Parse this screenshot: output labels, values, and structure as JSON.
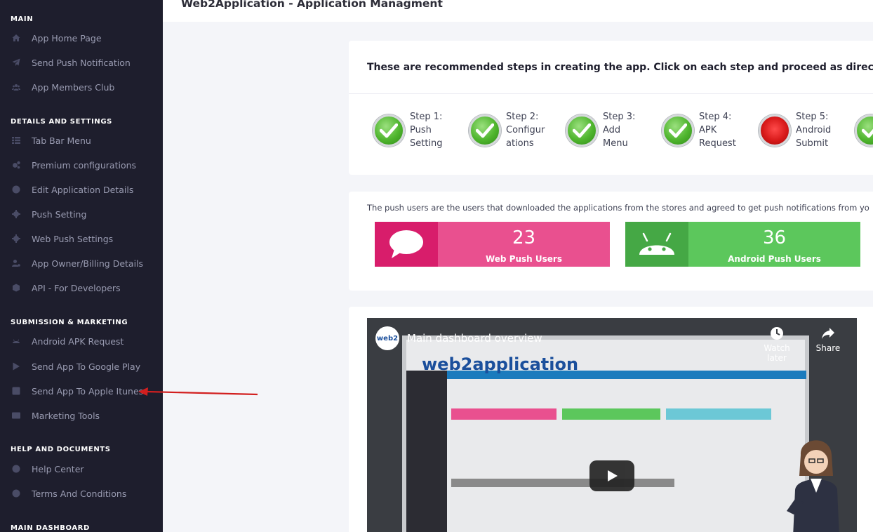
{
  "page": {
    "title": "Web2Application - Application Managment"
  },
  "sidebar": {
    "sections": [
      {
        "title": "MAIN",
        "items": [
          {
            "label": "App Home Page",
            "icon": "home-icon"
          },
          {
            "label": "Send Push Notification",
            "icon": "paper-plane-icon"
          },
          {
            "label": "App Members Club",
            "icon": "users-icon"
          }
        ]
      },
      {
        "title": "DETAILS AND SETTINGS",
        "items": [
          {
            "label": "Tab Bar Menu",
            "icon": "list-icon"
          },
          {
            "label": "Premium configurations",
            "icon": "cogs-icon"
          },
          {
            "label": "Edit Application Details",
            "icon": "info-icon"
          },
          {
            "label": "Push Setting",
            "icon": "gear-icon"
          },
          {
            "label": "Web Push Settings",
            "icon": "gear-icon"
          },
          {
            "label": "App Owner/Billing Details",
            "icon": "user-cog-icon"
          },
          {
            "label": "API - For Developers",
            "icon": "cube-icon"
          }
        ]
      },
      {
        "title": "SUBMISSION & MARKETING",
        "items": [
          {
            "label": "Android APK Request",
            "icon": "android-icon"
          },
          {
            "label": "Send App To Google Play",
            "icon": "google-play-icon"
          },
          {
            "label": "Send App To Apple Itunes",
            "icon": "app-store-icon"
          },
          {
            "label": "Marketing Tools",
            "icon": "ad-icon"
          }
        ]
      },
      {
        "title": "HELP AND DOCUMENTS",
        "items": [
          {
            "label": "Help Center",
            "icon": "question-icon"
          },
          {
            "label": "Terms And Conditions",
            "icon": "info-icon"
          }
        ]
      },
      {
        "title": "MAIN DASHBOARD",
        "items": []
      }
    ]
  },
  "steps": {
    "heading": "These are recommended steps in creating the app. Click on each step and proceed as directed",
    "items": [
      {
        "label": "Step 1: Push Setting",
        "status": "done"
      },
      {
        "label": "Step 2: Configurations",
        "status": "done"
      },
      {
        "label": "Step 3: Add Menu",
        "status": "done"
      },
      {
        "label": "Step 4: APK Request",
        "status": "done"
      },
      {
        "label": "Step 5: Android Submit",
        "status": "pending"
      },
      {
        "label": "",
        "status": "done"
      }
    ]
  },
  "push_users": {
    "description": "The push users are the users that downloaded the applications from the stores and agreed to get push notifications from yo",
    "stats": [
      {
        "count": "23",
        "label": "Web Push Users",
        "color": "#e9508f",
        "icon": "chat-bubble-icon"
      },
      {
        "count": "36",
        "label": "Android Push Users",
        "color": "#5cc75c",
        "icon": "android-icon"
      }
    ]
  },
  "video": {
    "title": "Main dashboard overview",
    "watch_later": "Watch later",
    "share": "Share",
    "brand": "web2application",
    "logo_text": "web2"
  }
}
